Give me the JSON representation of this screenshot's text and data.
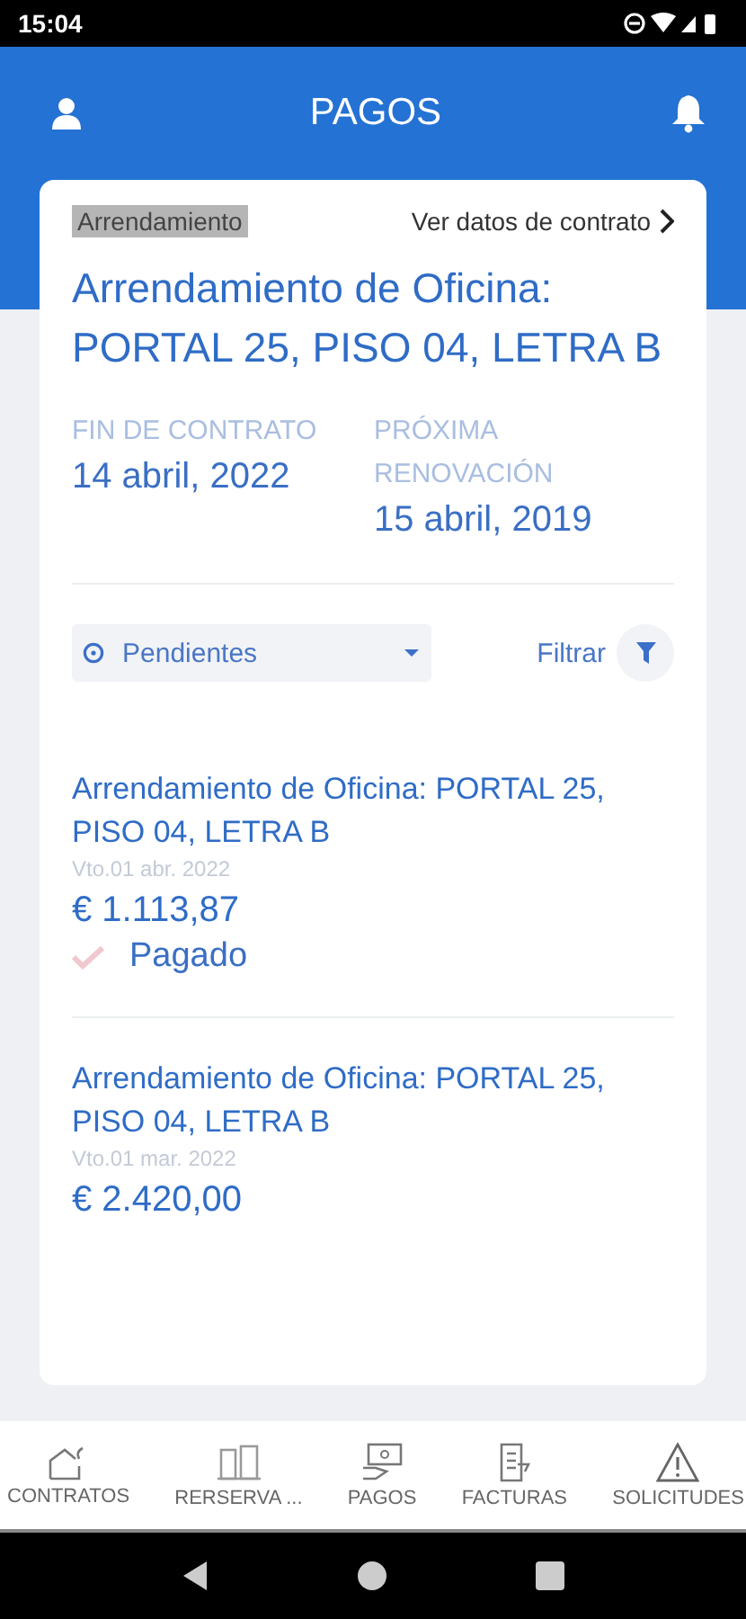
{
  "status_bar": {
    "time": "15:04"
  },
  "header": {
    "title": "PAGOS"
  },
  "contract": {
    "tag": "Arrendamiento",
    "link": "Ver datos de contrato",
    "title": "Arrendamiento de Oficina: PORTAL 25, PISO 04, LETRA B",
    "fields": [
      {
        "label": "FIN DE CONTRATO",
        "value": "14 abril, 2022"
      },
      {
        "label": "PRÓXIMA RENOVACIÓN",
        "value": "15 abril, 2019"
      }
    ]
  },
  "filter": {
    "dropdown": "Pendientes",
    "button": "Filtrar"
  },
  "payments": [
    {
      "title": "Arrendamiento de Oficina: PORTAL 25, PISO 04, LETRA B",
      "due": "Vto.01 abr. 2022",
      "amount": "€ 1.113,87",
      "status": "Pagado"
    },
    {
      "title": "Arrendamiento de Oficina: PORTAL 25, PISO 04, LETRA B",
      "due": "Vto.01 mar. 2022",
      "amount": "€ 2.420,00"
    }
  ],
  "bottom_nav": [
    {
      "kind": "house",
      "label": "CONTRATOS"
    },
    {
      "kind": "reserve",
      "label": "RERSERVA ..."
    },
    {
      "kind": "payment",
      "label": "PAGOS"
    },
    {
      "kind": "invoice",
      "label": "FACTURAS"
    },
    {
      "kind": "warning",
      "label": "SOLICITUDES"
    }
  ]
}
